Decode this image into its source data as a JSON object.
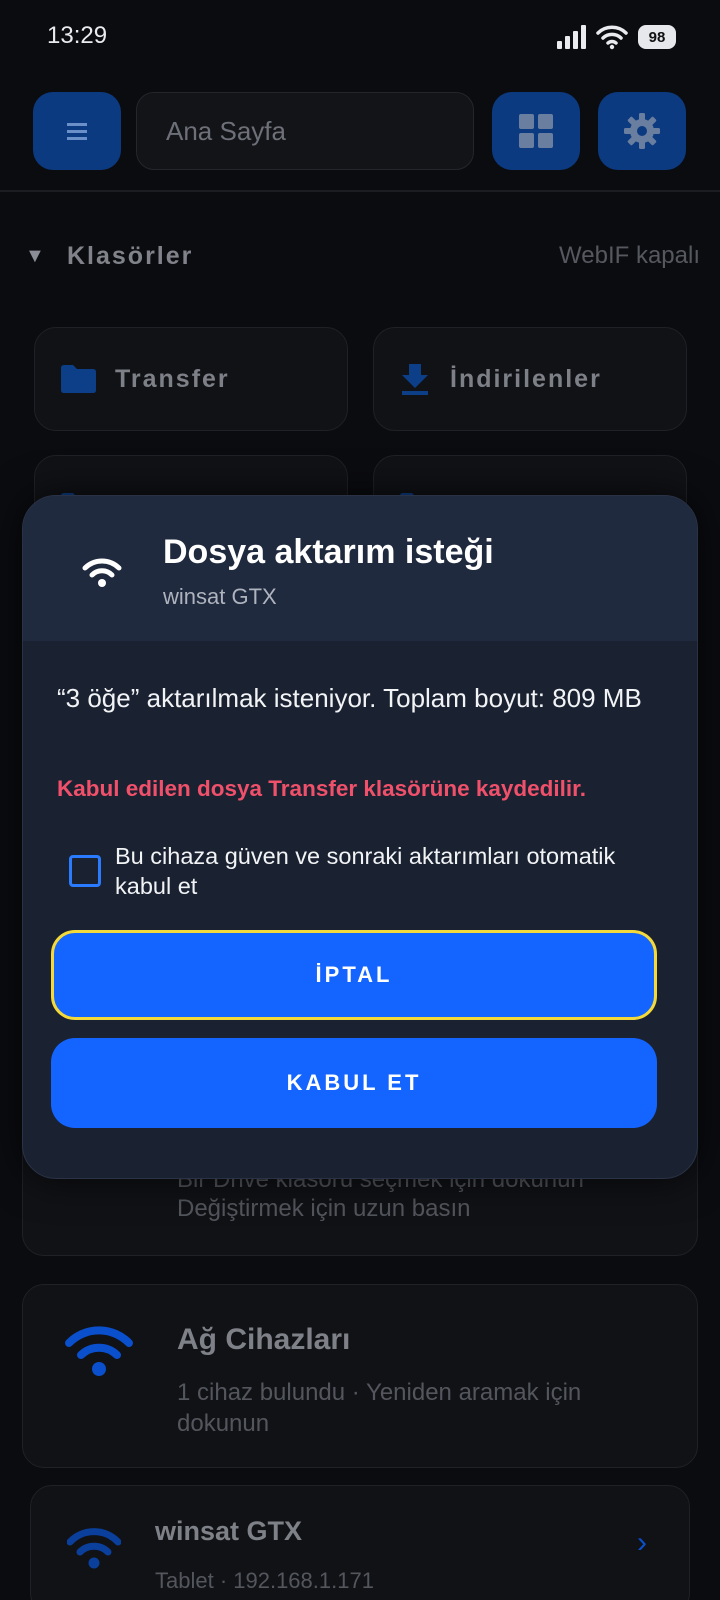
{
  "status_bar": {
    "time": "13:29",
    "battery": "98"
  },
  "toolbar": {
    "search_placeholder": "Ana Sayfa",
    "icons": {
      "menu": "menu-icon",
      "grid": "grid-icon",
      "settings": "gear-icon"
    }
  },
  "folders": {
    "title": "Klasörler",
    "webif_status": "WebIF kapalı",
    "items": [
      {
        "label": "Transfer",
        "icon": "folder-icon"
      },
      {
        "label": "İndirilenler",
        "icon": "download-icon"
      }
    ]
  },
  "drive": {
    "line1": "Bir Drive klasörü seçmek için dokunun",
    "line2": "Değiştirmek için uzun basın"
  },
  "network": {
    "title": "Ağ Cihazları",
    "subtitle": "1 cihaz bulundu · Yeniden aramak için dokunun"
  },
  "device": {
    "name": "winsat GTX",
    "details": "Tablet · 192.168.1.171"
  },
  "dialog": {
    "title": "Dosya aktarım isteği",
    "subtitle": "winsat GTX",
    "message": "“3 öğe” aktarılmak isteniyor. Toplam boyut: 809 MB",
    "warning": "Kabul edilen dosya Transfer klasörüne kaydedilir.",
    "trust_label": "Bu cihaza güven ve sonraki aktarımları otomatik kabul et",
    "trust_checked": false,
    "cancel_label": "İPTAL",
    "accept_label": "KABUL ET"
  },
  "colors": {
    "accent": "#1464ff",
    "warning": "#f0506a",
    "focus_ring": "#f4d93a",
    "dialog_bg": "#1a2232"
  }
}
